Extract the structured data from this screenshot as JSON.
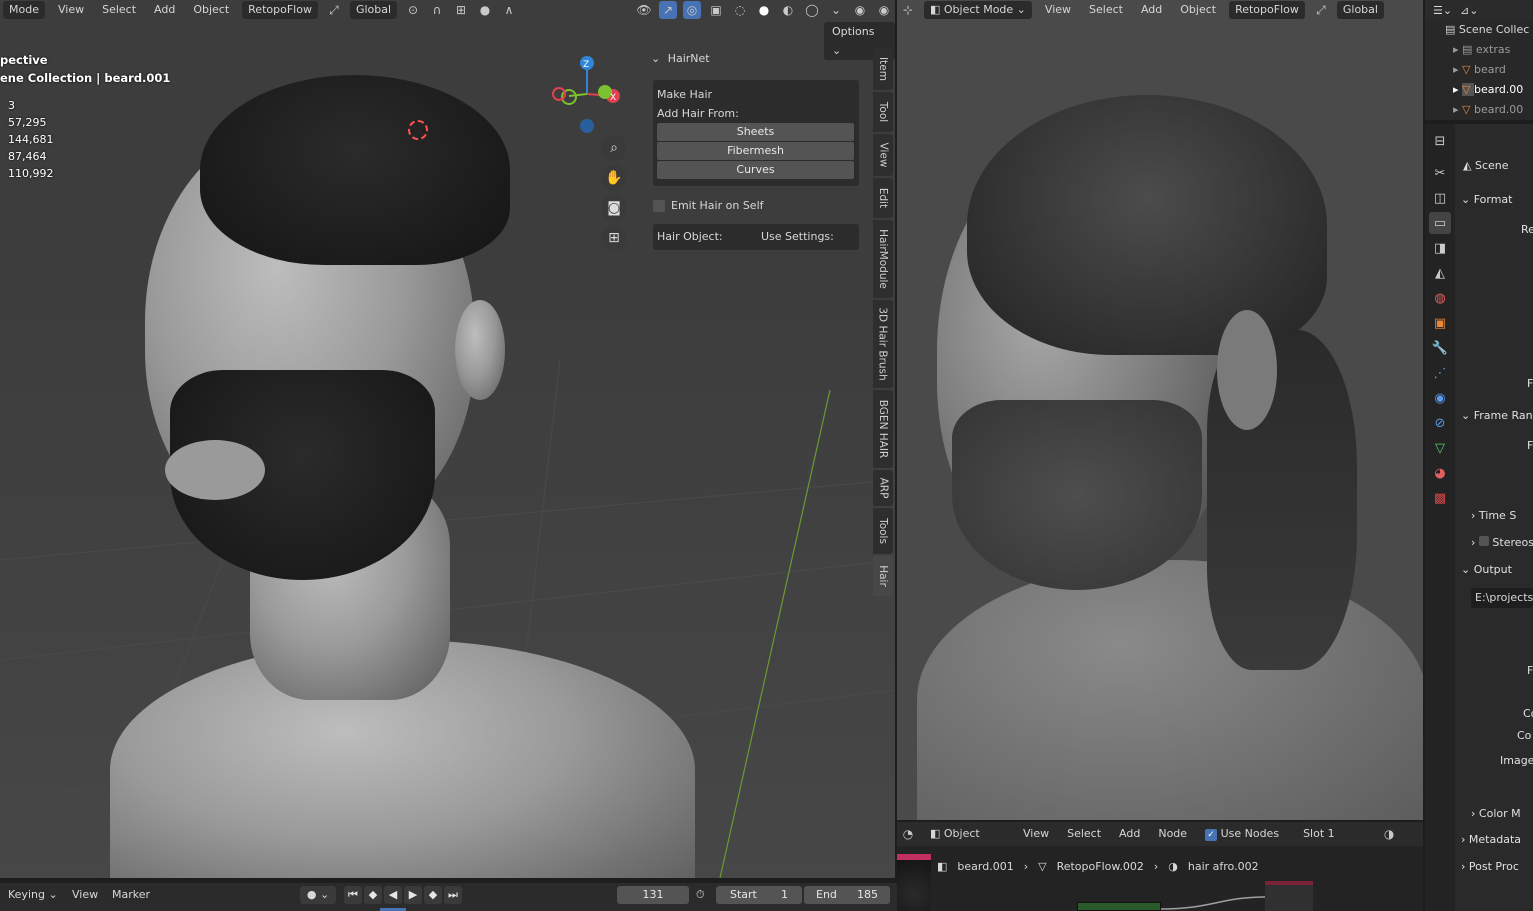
{
  "left_header": {
    "mode": "Mode",
    "menus": [
      "View",
      "Select",
      "Add",
      "Object"
    ],
    "addon_menu": "RetopoFlow",
    "transform_orientation": "Global"
  },
  "viewport_overlay": {
    "view_name": "pective",
    "collection_path": "ene Collection | beard.001",
    "stats": [
      "3",
      "57,295",
      "144,681",
      "87,464",
      "110,992"
    ]
  },
  "options_button": "Options",
  "gizmo": {
    "z": "Z",
    "x": "X"
  },
  "hairnet": {
    "title": "HairNet",
    "make_hair": "Make Hair",
    "add_hair_from": "Add Hair From:",
    "buttons": [
      "Sheets",
      "Fibermesh",
      "Curves"
    ],
    "emit_label": "Emit Hair on Self",
    "hair_object_label": "Hair Object:",
    "use_settings_label": "Use Settings:"
  },
  "side_tabs": [
    "Item",
    "Tool",
    "View",
    "Edit",
    "HairModule",
    "3D Hair Brush",
    "BGEN HAIR",
    "ARP",
    "Tools",
    "Hair"
  ],
  "right_header": {
    "mode": "Object Mode",
    "menus": [
      "View",
      "Select",
      "Add",
      "Object"
    ],
    "addon_menu": "RetopoFlow",
    "transform_orientation": "Global"
  },
  "outliner": {
    "root": "Scene Collec",
    "items": [
      "extras",
      "beard",
      "beard.00",
      "beard.00"
    ]
  },
  "properties": {
    "scene_label": "Scene",
    "sections": [
      "Format",
      "Frame Ran",
      "Time S",
      "Stereos",
      "Output",
      "Color M",
      "Metadata",
      "Post Proc"
    ],
    "output_path": "E:\\projects",
    "partial_labels": [
      "Re",
      "F",
      "F",
      "F",
      "Co",
      "Co",
      "Image"
    ]
  },
  "node_header": {
    "type": "Object",
    "menus": [
      "View",
      "Select",
      "Add",
      "Node"
    ],
    "use_nodes_label": "Use Nodes",
    "use_nodes_checked": true,
    "slot": "Slot 1"
  },
  "node_breadcrumb": [
    "beard.001",
    "RetopoFlow.002",
    "hair afro.002"
  ],
  "timeline": {
    "keying": "Keying",
    "view": "View",
    "marker": "Marker",
    "current_frame": "131",
    "start_label": "Start",
    "start_value": "1",
    "end_label": "End",
    "end_value": "185"
  },
  "colors": {
    "accent_blue": "#4772b3",
    "axis_x": "#e04050",
    "axis_y": "#7ac22e",
    "axis_z": "#2f86d8"
  }
}
